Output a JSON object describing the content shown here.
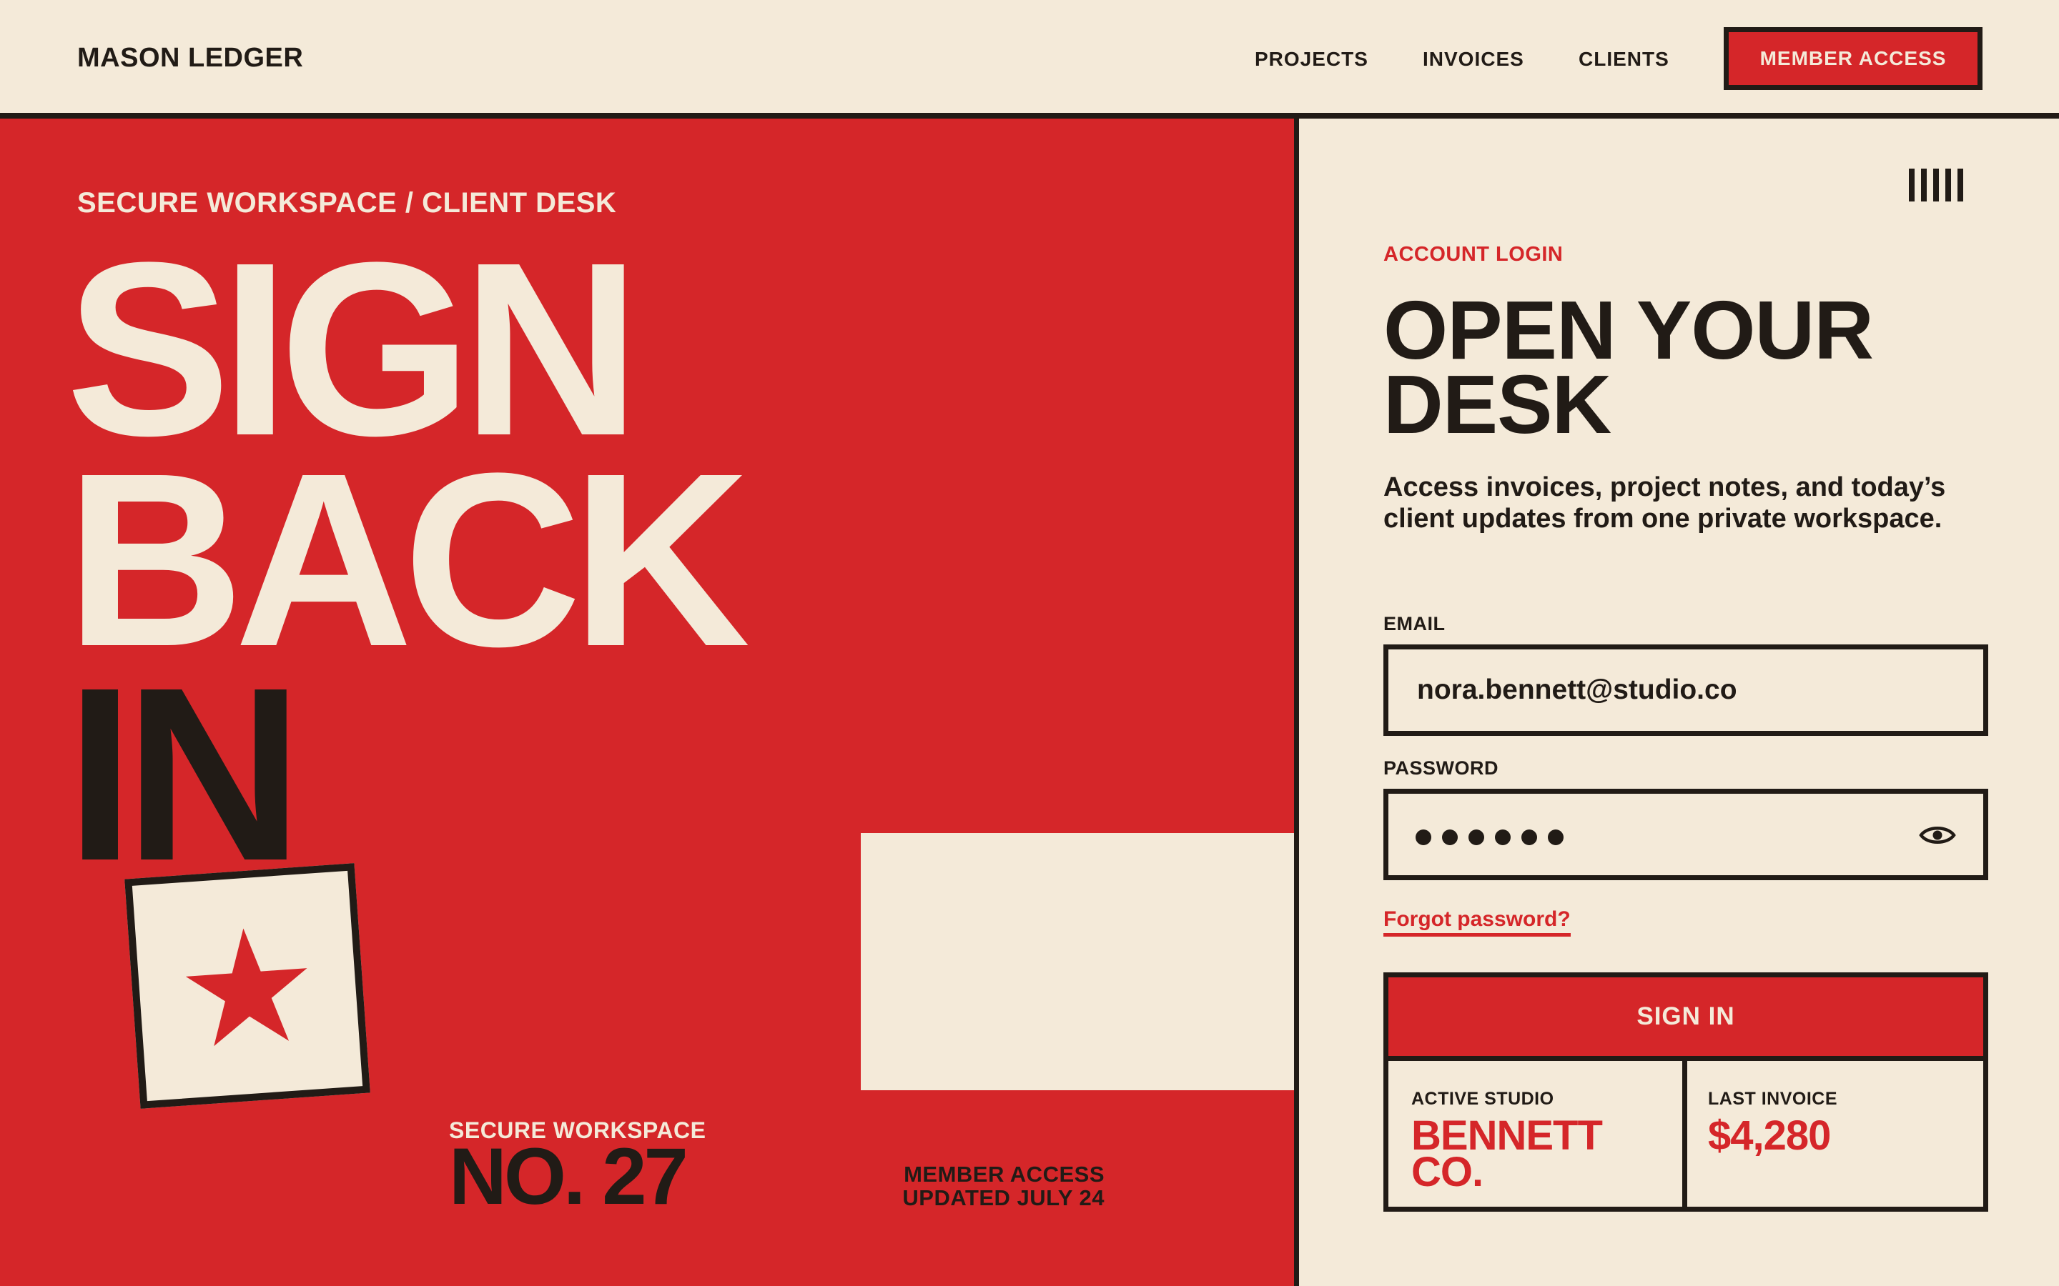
{
  "header": {
    "brand": "MASON LEDGER",
    "nav": [
      "PROJECTS",
      "INVOICES",
      "CLIENTS"
    ],
    "member_access": "MEMBER ACCESS"
  },
  "hero": {
    "eyebrow": "SECURE WORKSPACE / CLIENT DESK",
    "lines": [
      "SIGN",
      "BACK",
      "IN"
    ],
    "star_icon": "star-icon",
    "workspace_label": "SECURE WORKSPACE",
    "workspace_number": "NO. 27",
    "updated_line1": "MEMBER ACCESS",
    "updated_line2": "UPDATED JULY 24"
  },
  "login": {
    "eyebrow": "ACCOUNT LOGIN",
    "title_line1": "OPEN YOUR",
    "title_line2": "DESK",
    "description": "Access invoices, project notes, and today’s client updates from one private workspace.",
    "email_label": "EMAIL",
    "email_value": "nora.bennett@studio.co",
    "password_label": "PASSWORD",
    "password_dots": 6,
    "eye_icon": "eye-icon",
    "forgot": "Forgot password?",
    "signin": "SIGN IN"
  },
  "stats": {
    "active_label": "ACTIVE STUDIO",
    "active_value_line1": "BENNETT",
    "active_value_line2": "CO.",
    "invoice_label": "LAST INVOICE",
    "invoice_value": "$4,280"
  },
  "colors": {
    "red": "#d52629",
    "cream": "#f4ead9",
    "ink": "#211b16"
  }
}
